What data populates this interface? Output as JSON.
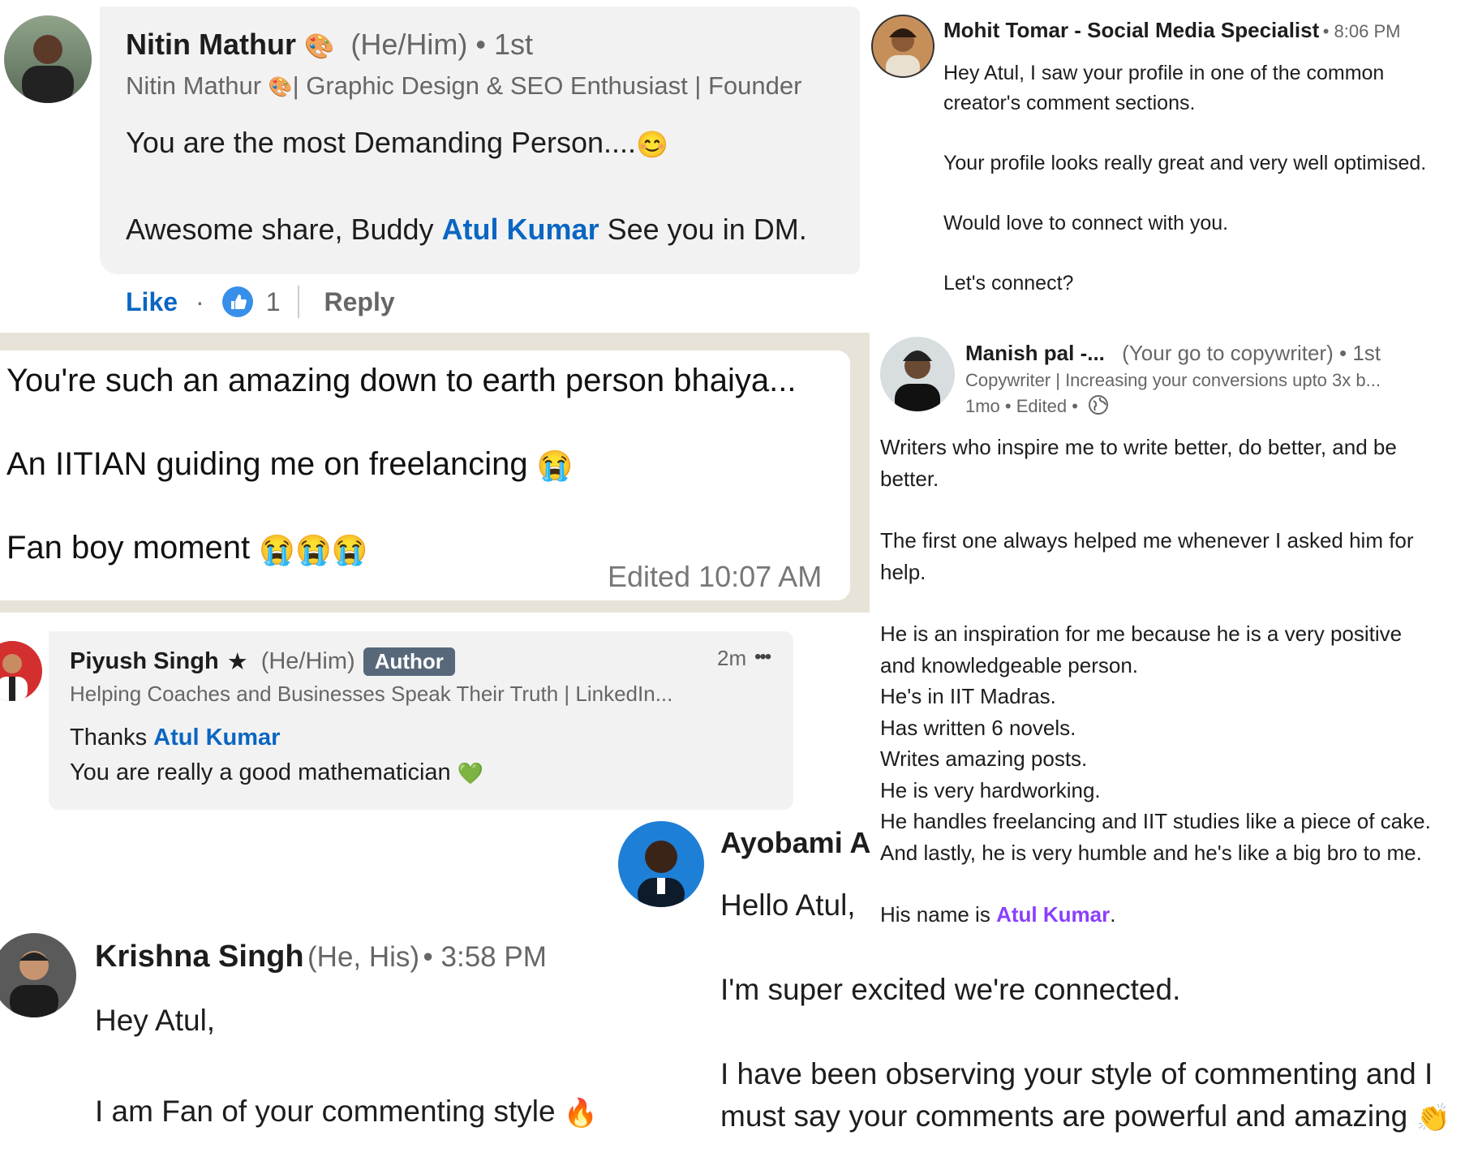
{
  "nitin": {
    "name": "Nitin Mathur",
    "pronouns": "(He/Him)",
    "degree": "• 1st",
    "headline": "Nitin Mathur",
    "headline_rest": "| Graphic Design & SEO Enthusiast | Founder",
    "line1": "You are the most Demanding Person....",
    "line2_pre": "Awesome share, Buddy",
    "mention": "Atul Kumar",
    "line2_post": "See you in DM.",
    "like_label": "Like",
    "dot": "·",
    "reaction_count": "1",
    "reply_label": "Reply",
    "colors": {
      "link": "#0a66c2",
      "bubble": "#f2f2f2"
    }
  },
  "mohit": {
    "name": "Mohit Tomar - Social Media Specialist",
    "time": "• 8:06 PM",
    "line1": "Hey Atul, I saw your profile in one of the common",
    "line2": "creator's comment sections.",
    "line3": "Your profile looks really great and very well optimised.",
    "line4": "Would love to connect with you.",
    "line5": "Let's connect?"
  },
  "whatsapp": {
    "line1": "You're such an amazing down to earth person bhaiya...",
    "line2": "An IITIAN guiding me on freelancing",
    "line3": "Fan boy moment",
    "meta": "Edited 10:07 AM"
  },
  "manish": {
    "name": "Manish pal -...",
    "tagline": "(Your go to copywriter)",
    "degree": "• 1st",
    "headline": "Copywriter | Increasing your conversions upto 3x b...",
    "meta": "1mo • Edited •",
    "lines": [
      "Writers who inspire me to write better, do better, and be",
      "better.",
      "The first one always helped me whenever I asked him for",
      "help.",
      "He is an inspiration for me because he is a very positive",
      "and knowledgeable person.",
      "He's in IIT Madras.",
      "Has written 6 novels.",
      "Writes amazing posts.",
      "He is very hardworking.",
      "He handles freelancing and IIT studies like a piece of cake.",
      "And lastly, he is very humble and he's like a big bro to me."
    ],
    "name_line_pre": "His name is",
    "name_line_mention": "Atul Kumar",
    "name_line_post": "."
  },
  "piyush": {
    "name": "Piyush Singh",
    "star": "★",
    "pronouns": "(He/Him)",
    "badge": "Author",
    "time": "2m",
    "more": "•••",
    "headline": "Helping Coaches and Businesses Speak Their Truth | LinkedIn...",
    "line1_pre": "Thanks",
    "mention": "Atul Kumar",
    "line2": "You are really a good mathematician"
  },
  "ayobami": {
    "name": "Ayobami A",
    "line1": "Hello Atul,",
    "line2": "I'm super excited we're connected.",
    "line3": "I have been observing your style of commenting and I",
    "line4": "must say your comments are powerful and amazing"
  },
  "krishna": {
    "name": "Krishna Singh",
    "pronouns": "(He, His)",
    "time": "• 3:58 PM",
    "line1": "Hey Atul,",
    "line2": "I am Fan of your commenting style"
  },
  "icons": [
    "palette-emoji-icon",
    "smile-emoji-icon",
    "thumbs-up-icon",
    "crying-emoji-icon",
    "globe-icon",
    "star-icon",
    "more-icon",
    "green-heart-icon",
    "fire-emoji-icon",
    "clapping-emoji-icon"
  ]
}
